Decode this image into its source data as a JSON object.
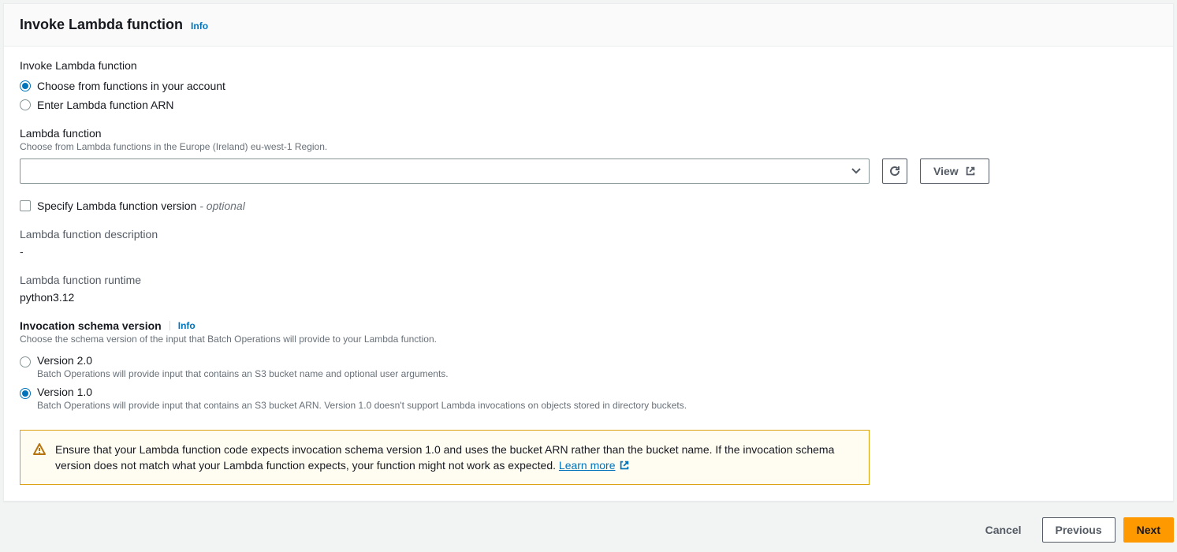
{
  "panel": {
    "title": "Invoke Lambda function",
    "info": "Info"
  },
  "source": {
    "label": "Invoke Lambda function",
    "options": {
      "account": "Choose from functions in your account",
      "arn": "Enter Lambda function ARN"
    }
  },
  "lambda_function": {
    "label": "Lambda function",
    "hint": "Choose from Lambda functions in the Europe (Ireland) eu-west-1 Region.",
    "view_label": "View"
  },
  "version_checkbox": {
    "label": "Specify Lambda function version",
    "optional": "- optional"
  },
  "description": {
    "label": "Lambda function description",
    "value": "-"
  },
  "runtime": {
    "label": "Lambda function runtime",
    "value": "python3.12"
  },
  "schema": {
    "label": "Invocation schema version",
    "info": "Info",
    "hint": "Choose the schema version of the input that Batch Operations will provide to your Lambda function.",
    "v2": {
      "label": "Version 2.0",
      "desc": "Batch Operations will provide input that contains an S3 bucket name and optional user arguments."
    },
    "v1": {
      "label": "Version 1.0",
      "desc": "Batch Operations will provide input that contains an S3 bucket ARN. Version 1.0 doesn't support Lambda invocations on objects stored in directory buckets."
    }
  },
  "alert": {
    "text": "Ensure that your Lambda function code expects invocation schema version 1.0 and uses the bucket ARN rather than the bucket name. If the invocation schema version does not match what your Lambda function expects, your function might not work as expected. ",
    "learn_more": "Learn more"
  },
  "footer": {
    "cancel": "Cancel",
    "previous": "Previous",
    "next": "Next"
  }
}
